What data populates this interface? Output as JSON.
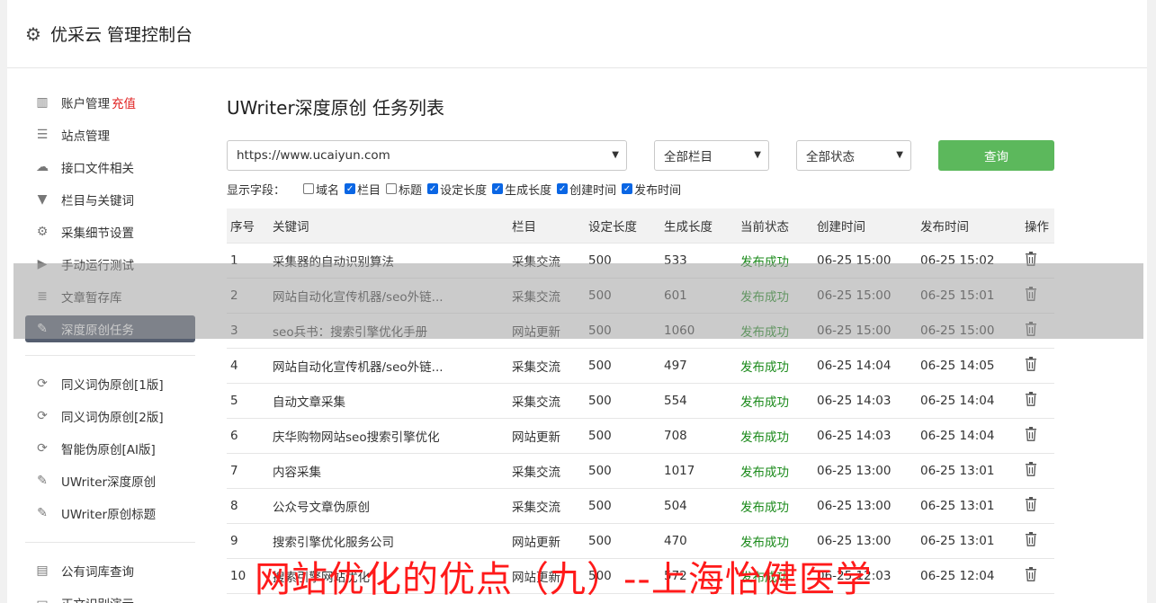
{
  "header": {
    "title": "优采云 管理控制台"
  },
  "sidebar": {
    "group1": [
      {
        "label": "账户管理",
        "extra": "充值",
        "icon": "bar-chart-icon"
      },
      {
        "label": "站点管理",
        "icon": "server-icon"
      },
      {
        "label": "接口文件相关",
        "icon": "cloud-upload-icon"
      },
      {
        "label": "栏目与关键词",
        "icon": "filter-icon"
      },
      {
        "label": "采集细节设置",
        "icon": "cogs-icon"
      },
      {
        "label": "手动运行测试",
        "icon": "play-circle-icon"
      },
      {
        "label": "文章暂存库",
        "icon": "database-icon"
      },
      {
        "label": "深度原创任务",
        "icon": "edit-icon"
      }
    ],
    "group2": [
      {
        "label": "同义词伪原创[1版]",
        "icon": "refresh-icon"
      },
      {
        "label": "同义词伪原创[2版]",
        "icon": "refresh-icon"
      },
      {
        "label": "智能伪原创[AI版]",
        "icon": "refresh-icon"
      },
      {
        "label": "UWriter深度原创",
        "icon": "edit-icon"
      },
      {
        "label": "UWriter原创标题",
        "icon": "edit-icon"
      }
    ],
    "group3": [
      {
        "label": "公有词库查询",
        "icon": "book-icon"
      },
      {
        "label": "正文识别演示",
        "icon": "monitor-icon"
      }
    ]
  },
  "main": {
    "title": "UWriter深度原创 任务列表",
    "site_select": "https://www.ucaiyun.com",
    "column_select": "全部栏目",
    "status_select": "全部状态",
    "query_label": "查询",
    "fields_label": "显示字段：",
    "fields": [
      {
        "label": "域名",
        "checked": false
      },
      {
        "label": "栏目",
        "checked": true
      },
      {
        "label": "标题",
        "checked": false
      },
      {
        "label": "设定长度",
        "checked": true
      },
      {
        "label": "生成长度",
        "checked": true
      },
      {
        "label": "创建时间",
        "checked": true
      },
      {
        "label": "发布时间",
        "checked": true
      }
    ],
    "columns": [
      "序号",
      "关键词",
      "栏目",
      "设定长度",
      "生成长度",
      "当前状态",
      "创建时间",
      "发布时间",
      "操作"
    ],
    "rows": [
      [
        "1",
        "采集器的自动识别算法",
        "采集交流",
        "500",
        "533",
        "发布成功",
        "06-25 15:00",
        "06-25 15:02"
      ],
      [
        "2",
        "网站自动化宣传机器/seo外链...",
        "采集交流",
        "500",
        "601",
        "发布成功",
        "06-25 15:00",
        "06-25 15:01"
      ],
      [
        "3",
        "seo兵书：搜索引擎优化手册",
        "网站更新",
        "500",
        "1060",
        "发布成功",
        "06-25 15:00",
        "06-25 15:00"
      ],
      [
        "4",
        "网站自动化宣传机器/seo外链...",
        "采集交流",
        "500",
        "497",
        "发布成功",
        "06-25 14:04",
        "06-25 14:05"
      ],
      [
        "5",
        "自动文章采集",
        "采集交流",
        "500",
        "554",
        "发布成功",
        "06-25 14:03",
        "06-25 14:04"
      ],
      [
        "6",
        "庆华购物网站seo搜索引擎优化",
        "网站更新",
        "500",
        "708",
        "发布成功",
        "06-25 14:03",
        "06-25 14:04"
      ],
      [
        "7",
        "内容采集",
        "采集交流",
        "500",
        "1017",
        "发布成功",
        "06-25 13:00",
        "06-25 13:01"
      ],
      [
        "8",
        "公众号文章伪原创",
        "采集交流",
        "500",
        "504",
        "发布成功",
        "06-25 13:00",
        "06-25 13:01"
      ],
      [
        "9",
        "搜索引擎优化服务公司",
        "网站更新",
        "500",
        "470",
        "发布成功",
        "06-25 13:00",
        "06-25 13:01"
      ],
      [
        "10",
        "搜索引擎网站优化",
        "网站更新",
        "500",
        "572",
        "发布成功",
        "06-25 12:03",
        "06-25 12:04"
      ]
    ]
  },
  "watermark": "网站优化的优点（九）--上海怡健医学",
  "colors": {
    "accent": "#5cb85c",
    "active_nav": "#555e6f",
    "recharge": "#e02020",
    "success": "#1a8a1a",
    "watermark": "#ff1a1a"
  }
}
